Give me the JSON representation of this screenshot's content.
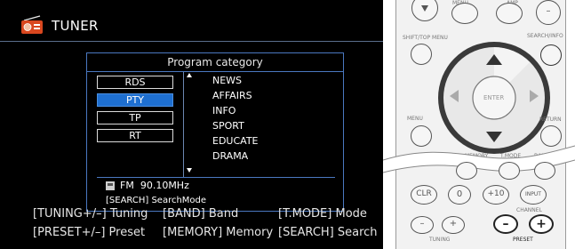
{
  "screen": {
    "title": "TUNER",
    "popup": {
      "title": "Program category",
      "categories": [
        "RDS",
        "PTY",
        "TP",
        "RT"
      ],
      "selected_category": "PTY",
      "pty_list": [
        "NEWS",
        "AFFAIRS",
        "INFO",
        "SPORT",
        "EDUCATE",
        "DRAMA"
      ],
      "band": "FM",
      "frequency": "90.10MHz",
      "search_hint": "[SEARCH] SearchMode"
    },
    "help": {
      "tuning": "[TUNING+/–] Tuning",
      "band": "[BAND] Band",
      "tmode": "[T.MODE] Mode",
      "preset": "[PRESET+/–] Preset",
      "memory": "[MEMORY] Memory",
      "search": "[SEARCH] Search"
    }
  },
  "remote": {
    "labels": {
      "menu_top": "MENU",
      "amp": "AMP",
      "shift_top_menu": "SHIFT/TOP MENU",
      "search_info": "SEARCH/INFO",
      "enter": "ENTER",
      "menu": "MENU",
      "return": "RETURN",
      "memory": "MEMORY",
      "tmode": "T.MODE",
      "band": "BAND",
      "clr": "CLR",
      "zero": "0",
      "plus10": "+10",
      "input": "INPUT",
      "channel": "CHANNEL",
      "tuning": "TUNING",
      "preset": "PRESET",
      "minus": "–",
      "plus": "+"
    },
    "accent_dark": "#333333"
  }
}
